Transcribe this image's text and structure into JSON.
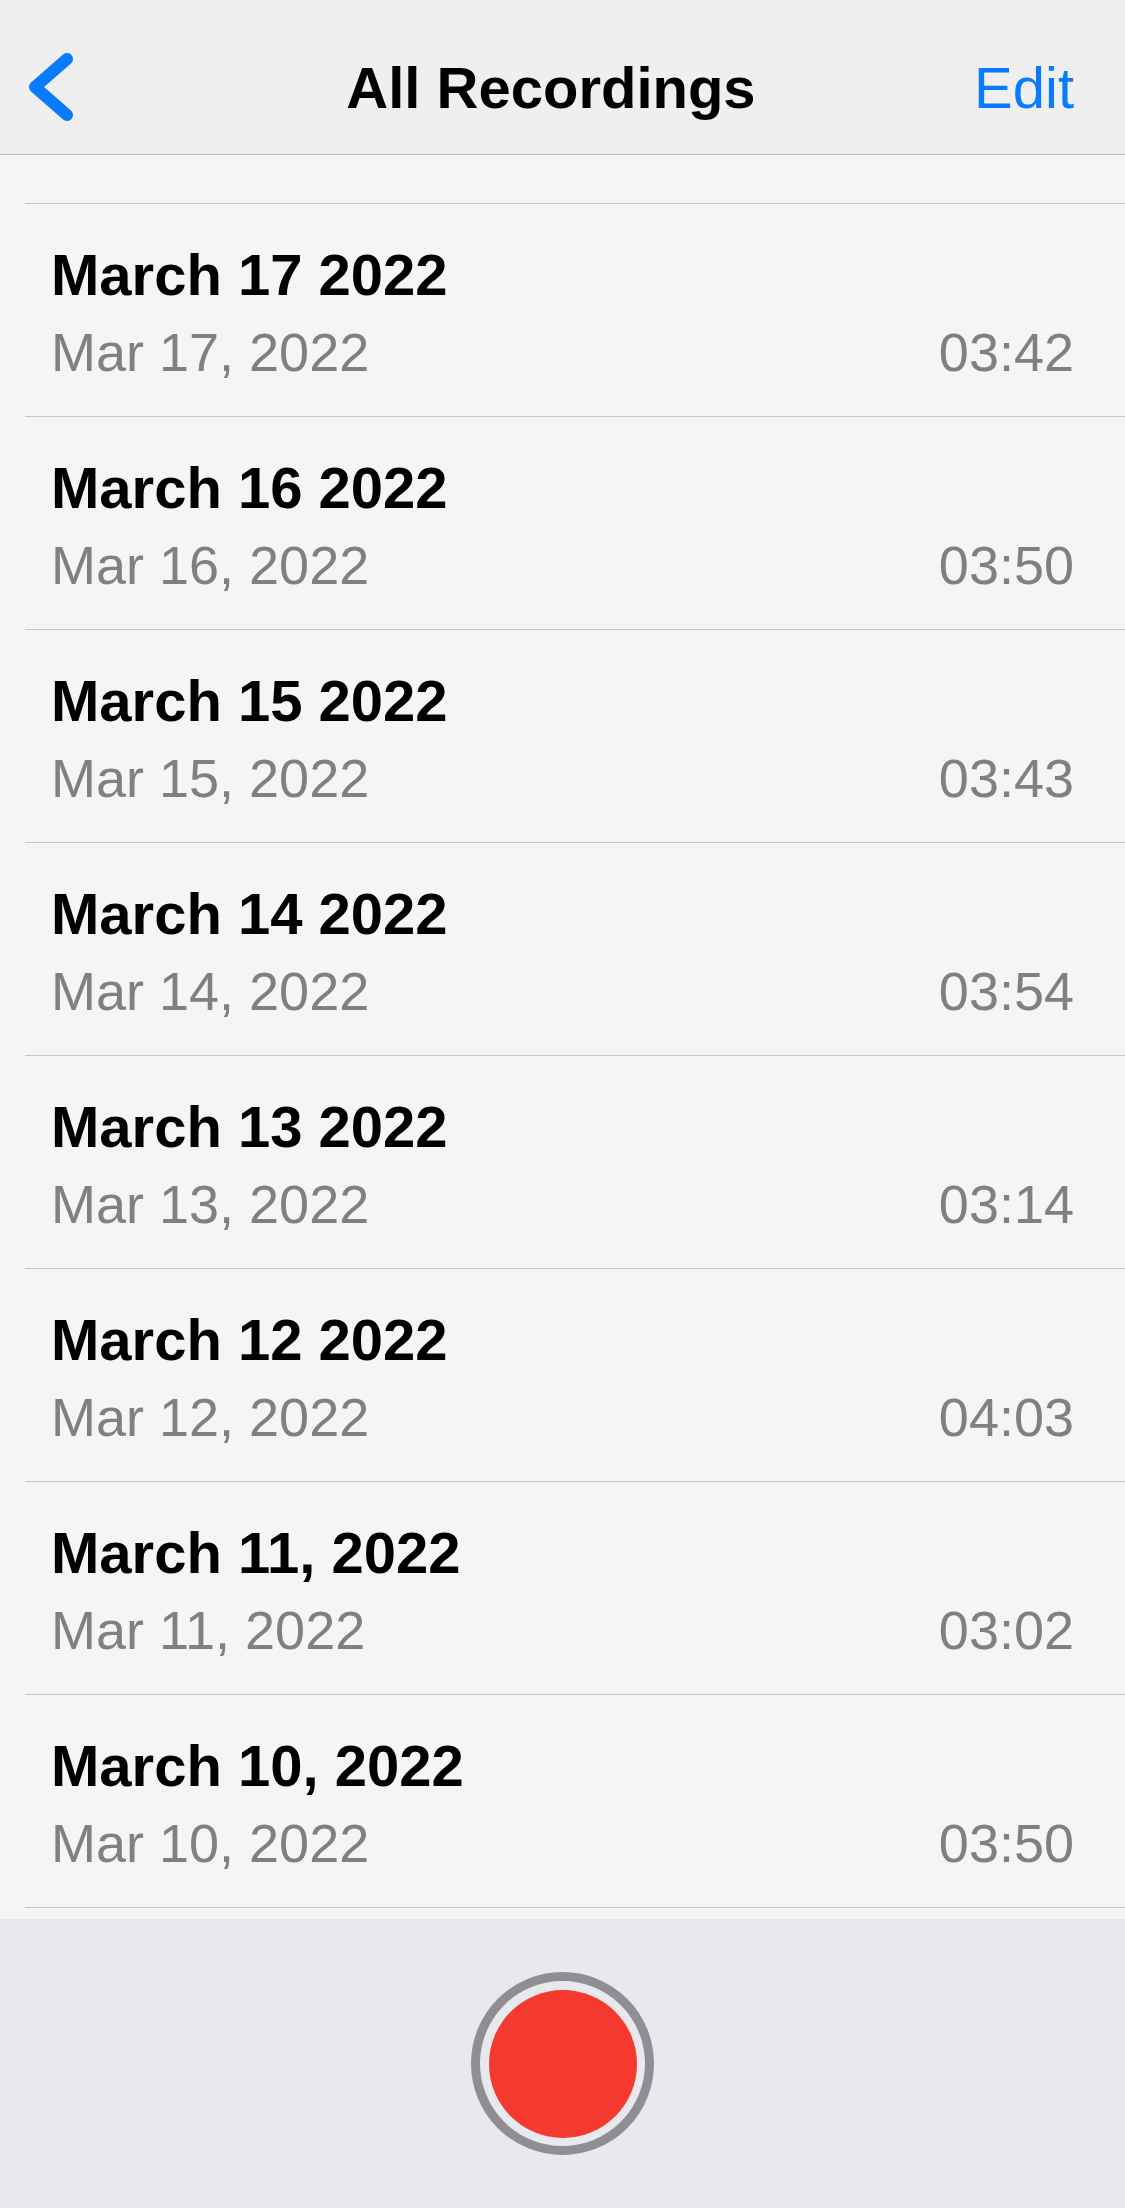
{
  "nav": {
    "title": "All Recordings",
    "edit": "Edit"
  },
  "recordings": [
    {
      "title": "March 17 2022",
      "date": "Mar 17, 2022",
      "duration": "03:42"
    },
    {
      "title": "March 16 2022",
      "date": "Mar 16, 2022",
      "duration": "03:50"
    },
    {
      "title": "March 15 2022",
      "date": "Mar 15, 2022",
      "duration": "03:43"
    },
    {
      "title": "March 14 2022",
      "date": "Mar 14, 2022",
      "duration": "03:54"
    },
    {
      "title": "March 13 2022",
      "date": "Mar 13, 2022",
      "duration": "03:14"
    },
    {
      "title": "March 12 2022",
      "date": "Mar 12, 2022",
      "duration": "04:03"
    },
    {
      "title": "March 11, 2022",
      "date": "Mar 11, 2022",
      "duration": "03:02"
    },
    {
      "title": "March 10, 2022",
      "date": "Mar 10, 2022",
      "duration": "03:50"
    }
  ]
}
